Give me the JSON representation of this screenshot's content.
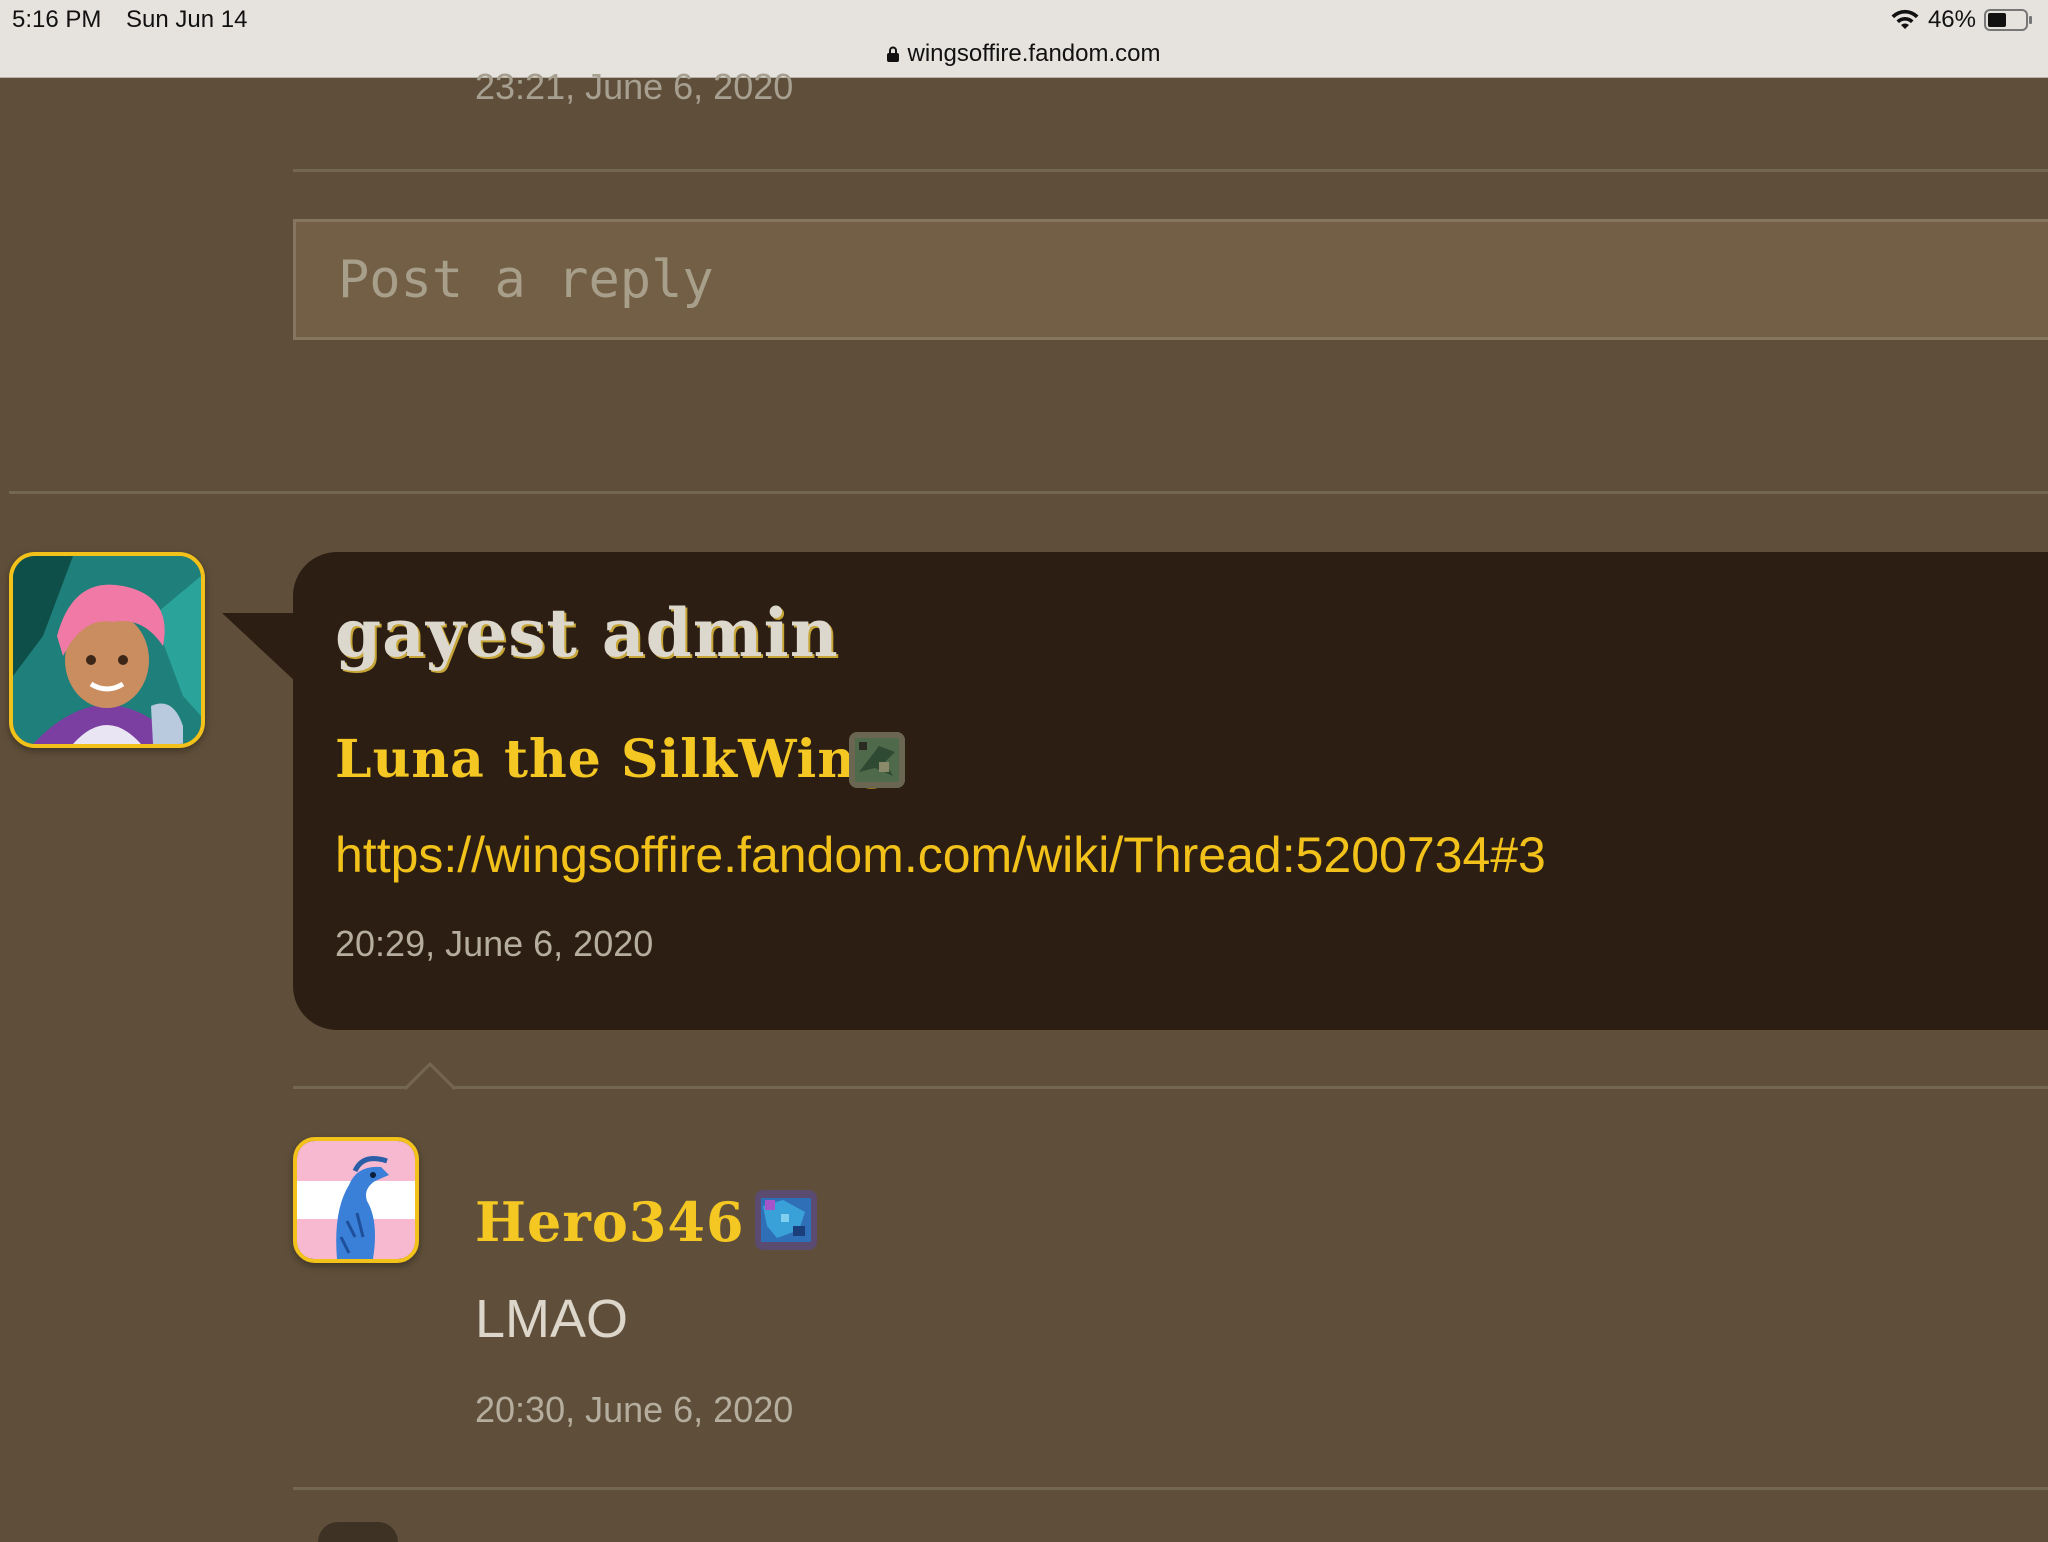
{
  "status_bar": {
    "time": "5:16 PM",
    "date": "Sun Jun 14",
    "battery": "46%",
    "url": "wingsoffire.fandom.com"
  },
  "previous_post": {
    "timestamp": "23:21, June 6, 2020"
  },
  "reply_box": {
    "placeholder": "Post a reply"
  },
  "thread": {
    "title": "gayest admin",
    "author": "Luna the SilkWing",
    "author_badge_icon": "dragon-badge-icon",
    "body_link": "https://wingsoffire.fandom.com/wiki/Thread:5200734#3",
    "timestamp": "20:29, June 6, 2020"
  },
  "replies": [
    {
      "author": "Hero346",
      "author_badge_icon": "dragon-badge-icon",
      "body": "LMAO",
      "timestamp": "20:30, June 6, 2020"
    }
  ],
  "colors": {
    "page_background": "#5f4f3a",
    "bubble_background": "#2c1e13",
    "accent_gold": "#f2c21b",
    "reply_box": "#735f45"
  }
}
